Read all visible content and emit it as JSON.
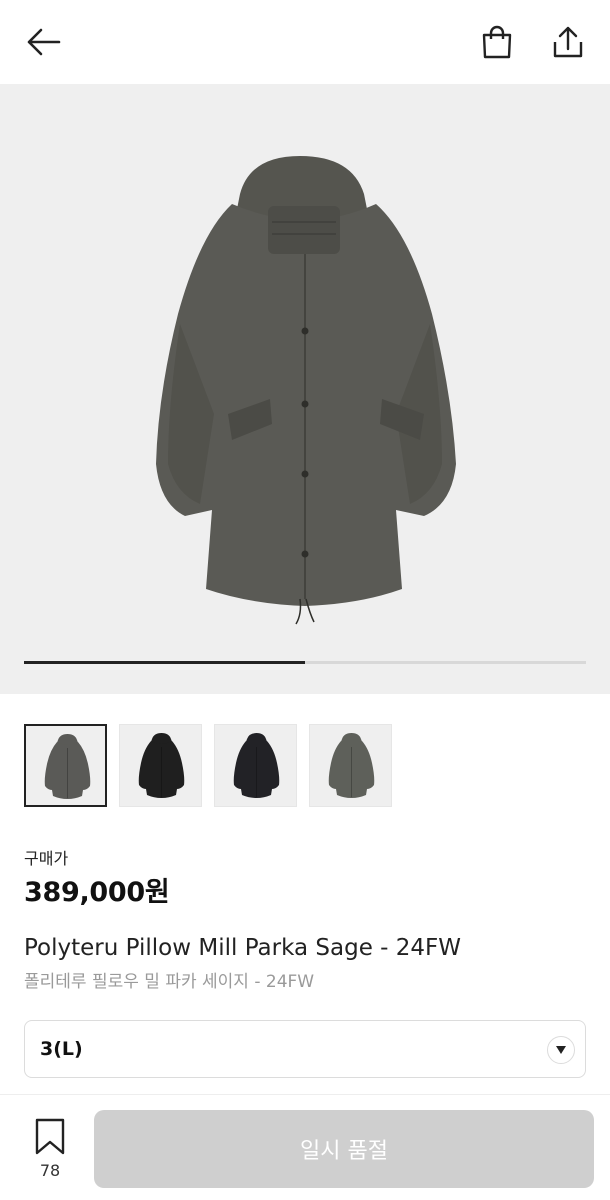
{
  "header": {
    "back_icon": "arrow-left-icon",
    "bag_icon": "shopping-bag-icon",
    "share_icon": "share-icon"
  },
  "gallery": {
    "progress": 0.5,
    "thumbnails": [
      {
        "color": "#5a5a57",
        "active": true
      },
      {
        "color": "#1f1f1f",
        "active": false
      },
      {
        "color": "#222226",
        "active": false
      },
      {
        "color": "#5e605a",
        "active": false
      }
    ]
  },
  "product": {
    "price_label": "구매가",
    "price": "389,000원",
    "name_en": "Polyteru Pillow Mill Parka Sage - 24FW",
    "name_ko": "폴리테루 필로우 밀 파카 세이지 - 24FW"
  },
  "size_select": {
    "value": "3(L)"
  },
  "bottom": {
    "wish_count": "78",
    "soldout_label": "일시 품절"
  },
  "colors": {
    "accent": "#222222",
    "disabled": "#cfcfcf"
  }
}
